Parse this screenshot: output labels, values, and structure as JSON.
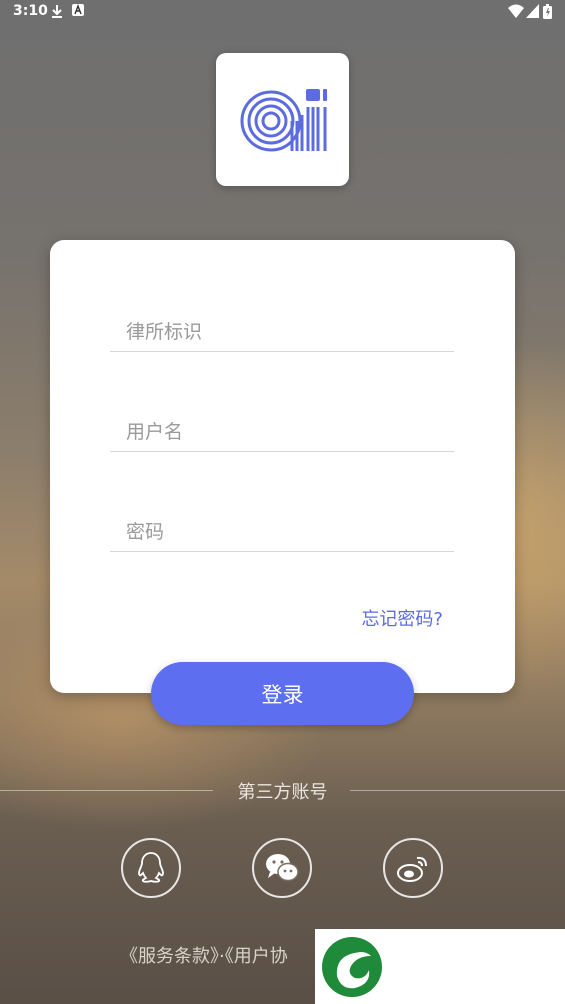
{
  "status_bar": {
    "time": "3:10"
  },
  "form": {
    "firm_id_placeholder": "律所标识",
    "username_placeholder": "用户名",
    "password_placeholder": "密码",
    "forgot_password": "忘记密码?",
    "login_button": "登录"
  },
  "third_party": {
    "label": "第三方账号",
    "providers": [
      "qq-icon",
      "wechat-icon",
      "weibo-icon"
    ]
  },
  "footer": {
    "terms_text": "《服务条款》·《用户协"
  },
  "colors": {
    "accent": "#5e6ef0",
    "logo": "#5c6ce0"
  }
}
